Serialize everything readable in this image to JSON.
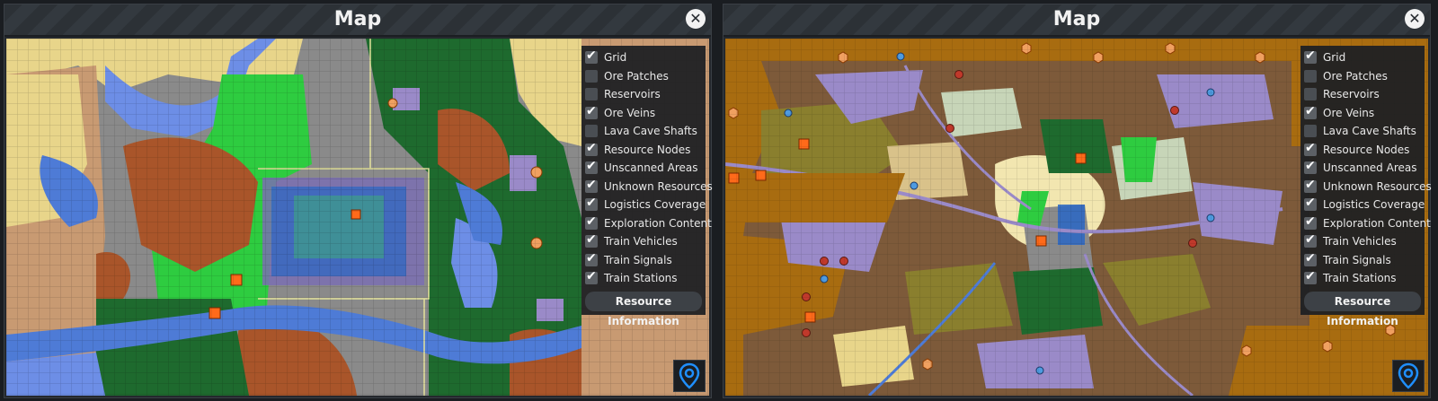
{
  "colors": {
    "panel_bg": "#24282d",
    "grass": "#2ecc40",
    "forest": "#1e6a2e",
    "rock": "#8a8a8a",
    "sand": "#e8d58a",
    "water": "#4e7bd6",
    "dirt": "#a9552a",
    "lavender": "#9a8ac8",
    "ochre": "#a86c10",
    "pin": "#1f8fff"
  },
  "icons": [
    "close-icon",
    "checkmark-icon",
    "map-pin-icon"
  ],
  "panels": [
    {
      "title": "Map",
      "layers": [
        {
          "label": "Grid",
          "checked": true
        },
        {
          "label": "Ore Patches",
          "checked": false
        },
        {
          "label": "Reservoirs",
          "checked": false
        },
        {
          "label": "Ore Veins",
          "checked": true
        },
        {
          "label": "Lava Cave Shafts",
          "checked": false
        },
        {
          "label": "Resource Nodes",
          "checked": true
        },
        {
          "label": "Unscanned Areas",
          "checked": true
        },
        {
          "label": "Unknown Resources",
          "checked": true
        },
        {
          "label": "Logistics Coverage",
          "checked": true
        },
        {
          "label": "Exploration Content",
          "checked": true
        },
        {
          "label": "Train Vehicles",
          "checked": true
        },
        {
          "label": "Train Signals",
          "checked": true
        },
        {
          "label": "Train Stations",
          "checked": true
        }
      ],
      "resource_button": "Resource Information"
    },
    {
      "title": "Map",
      "layers": [
        {
          "label": "Grid",
          "checked": true
        },
        {
          "label": "Ore Patches",
          "checked": false
        },
        {
          "label": "Reservoirs",
          "checked": false
        },
        {
          "label": "Ore Veins",
          "checked": true
        },
        {
          "label": "Lava Cave Shafts",
          "checked": false
        },
        {
          "label": "Resource Nodes",
          "checked": true
        },
        {
          "label": "Unscanned Areas",
          "checked": true
        },
        {
          "label": "Unknown Resources",
          "checked": true
        },
        {
          "label": "Logistics Coverage",
          "checked": true
        },
        {
          "label": "Exploration Content",
          "checked": true
        },
        {
          "label": "Train Vehicles",
          "checked": true
        },
        {
          "label": "Train Signals",
          "checked": true
        },
        {
          "label": "Train Stations",
          "checked": true
        }
      ],
      "resource_button": "Resource Information"
    }
  ]
}
